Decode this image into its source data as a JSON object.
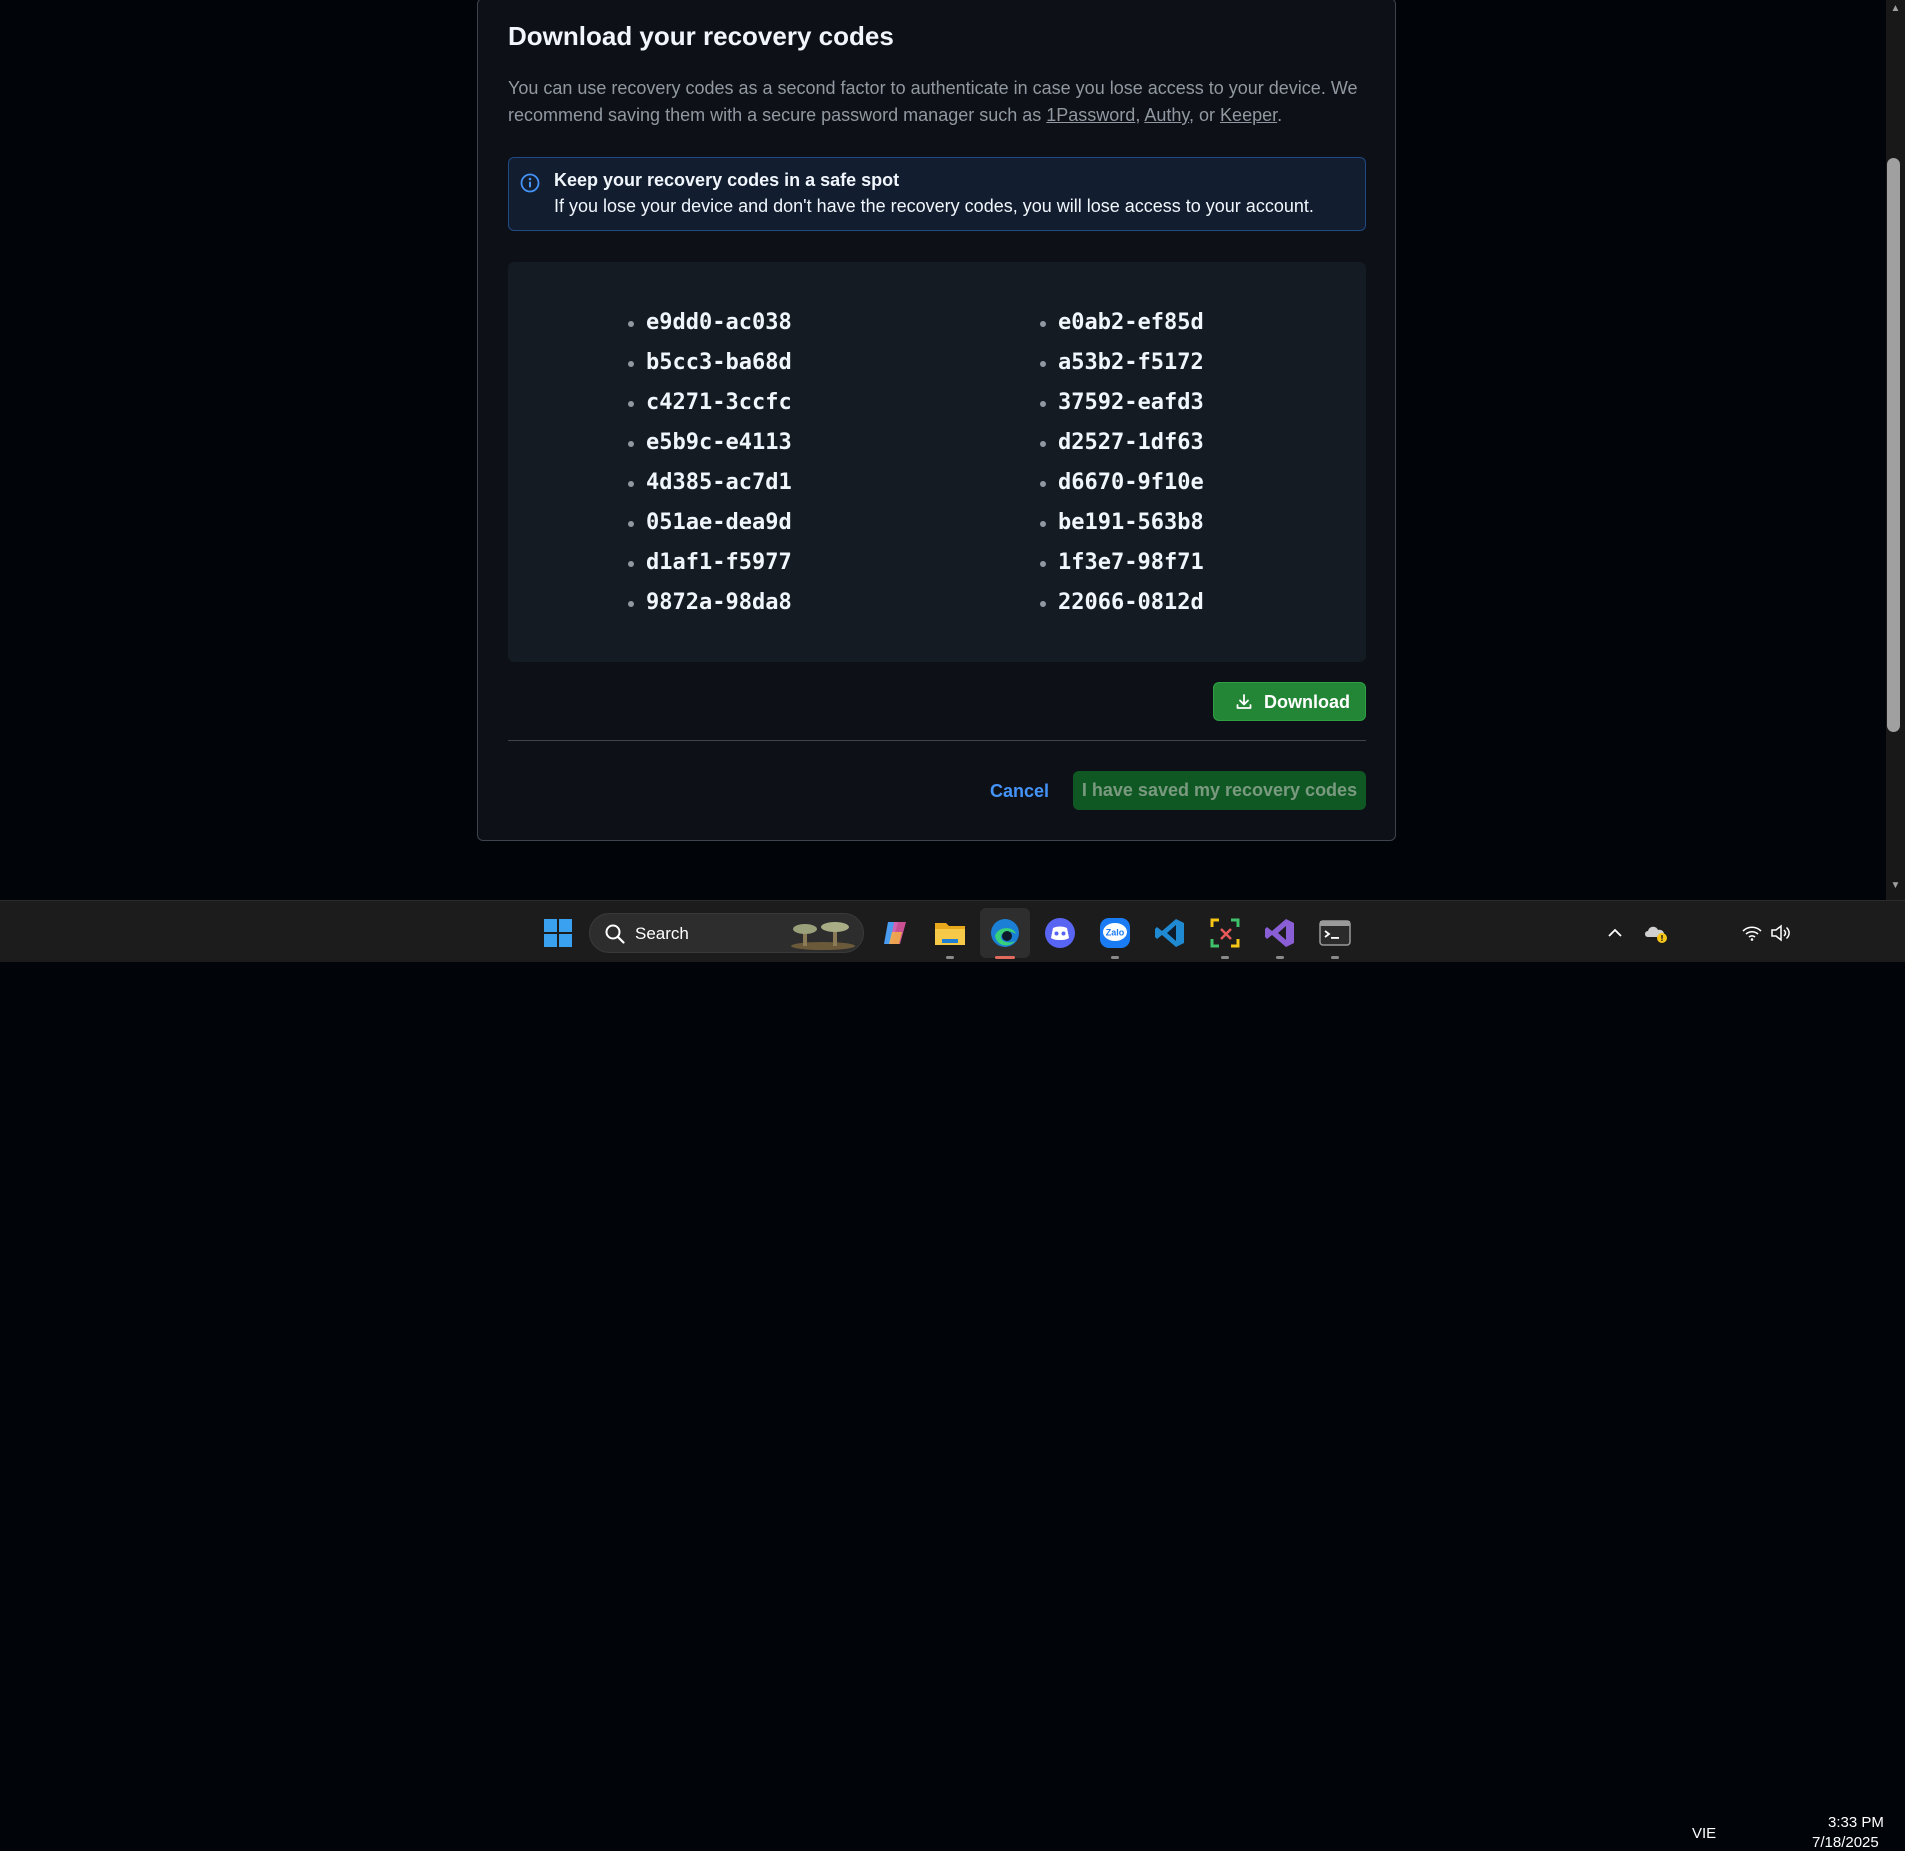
{
  "dialog": {
    "title": "Download your recovery codes",
    "desc_part1": "You can use recovery codes as a second factor to authenticate in case you lose access to your device. We recommend saving them with a secure password manager such as ",
    "link_1password": "1Password",
    "sep1": ", ",
    "link_authy": "Authy",
    "sep2": ", or ",
    "link_keeper": "Keeper",
    "desc_end": ".",
    "flash": {
      "title": "Keep your recovery codes in a safe spot",
      "text": "If you lose your device and don't have the recovery codes, you will lose access to your account."
    },
    "codes_left": [
      "e9dd0-ac038",
      "b5cc3-ba68d",
      "c4271-3ccfc",
      "e5b9c-e4113",
      "4d385-ac7d1",
      "051ae-dea9d",
      "d1af1-f5977",
      "9872a-98da8"
    ],
    "codes_right": [
      "e0ab2-ef85d",
      "a53b2-f5172",
      "37592-eafd3",
      "d2527-1df63",
      "d6670-9f10e",
      "be191-563b8",
      "1f3e7-98f71",
      "22066-0812d"
    ],
    "download_label": "Download",
    "cancel_label": "Cancel",
    "saved_label": "I have saved my recovery codes"
  },
  "taskbar": {
    "search_placeholder": "Search",
    "apps": [
      "start-icon",
      "copilot-icon",
      "file-explorer-icon",
      "edge-icon",
      "discord-icon",
      "zalo-icon",
      "vscode-icon",
      "snipping-tool-icon",
      "visual-studio-icon",
      "terminal-icon"
    ],
    "zalo_text": "Zalo",
    "language": "VIE",
    "time": "3:33 PM",
    "date": "7/18/2025"
  },
  "colors": {
    "page_bg": "#010409",
    "dialog_bg": "#0d1117",
    "accent_green": "#238636",
    "link_blue": "#4493f8",
    "flash_border": "#1f4a83"
  }
}
